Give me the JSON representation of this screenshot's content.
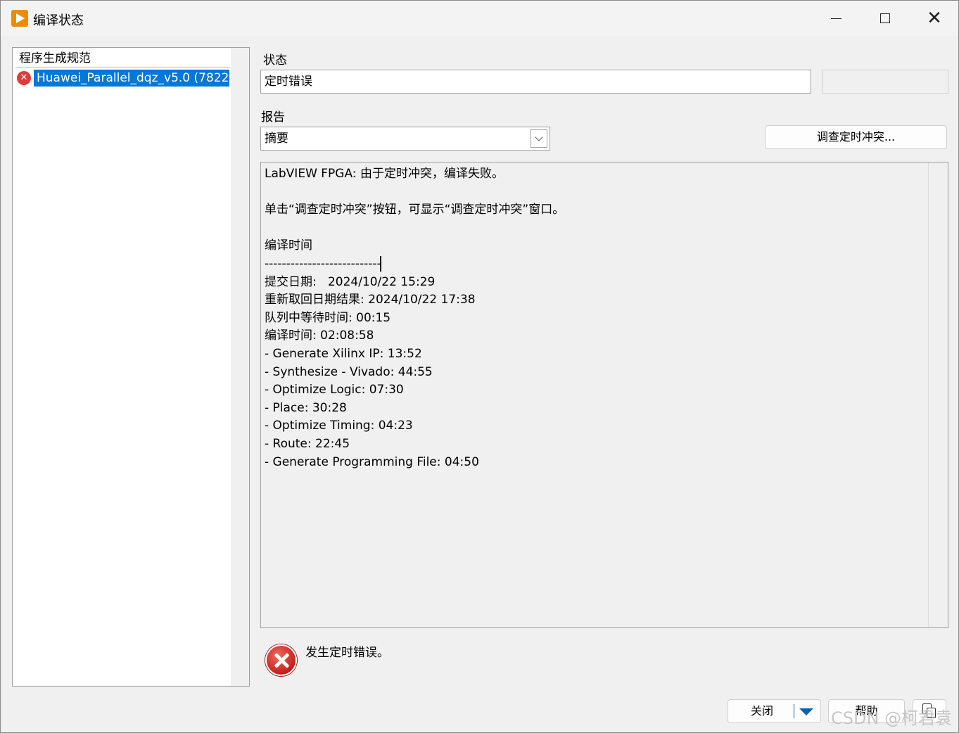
{
  "window": {
    "title": "编译状态"
  },
  "left_panel": {
    "header": "程序生成规范",
    "items": [
      {
        "label": "Huawei_Parallel_dqz_v5.0 (7822",
        "status": "error"
      }
    ]
  },
  "status": {
    "label": "状态",
    "value": "定时错误"
  },
  "report": {
    "label": "报告",
    "selected": "摘要",
    "investigate_button": "调查定时冲突...",
    "lines": [
      "LabVIEW FPGA: 由于定时冲突，编译失败。",
      "",
      "单击“调查定时冲突”按钮，可显示“调查定时冲突”窗口。",
      "",
      "编译时间",
      "---------------------------",
      "提交日期:   2024/10/22 15:29",
      "重新取回日期结果: 2024/10/22 17:38",
      "队列中等待时间: 00:15",
      "编译时间: 02:08:58",
      "- Generate Xilinx IP: 13:52",
      "- Synthesize - Vivado: 44:55",
      "- Optimize Logic: 07:30",
      "- Place: 30:28",
      "- Optimize Timing: 04:23",
      "- Route: 22:45",
      "- Generate Programming File: 04:50"
    ]
  },
  "error_message": "发生定时错误。",
  "buttons": {
    "close": "关闭",
    "help": "帮助"
  },
  "watermark": "CSDN @柯君袁"
}
